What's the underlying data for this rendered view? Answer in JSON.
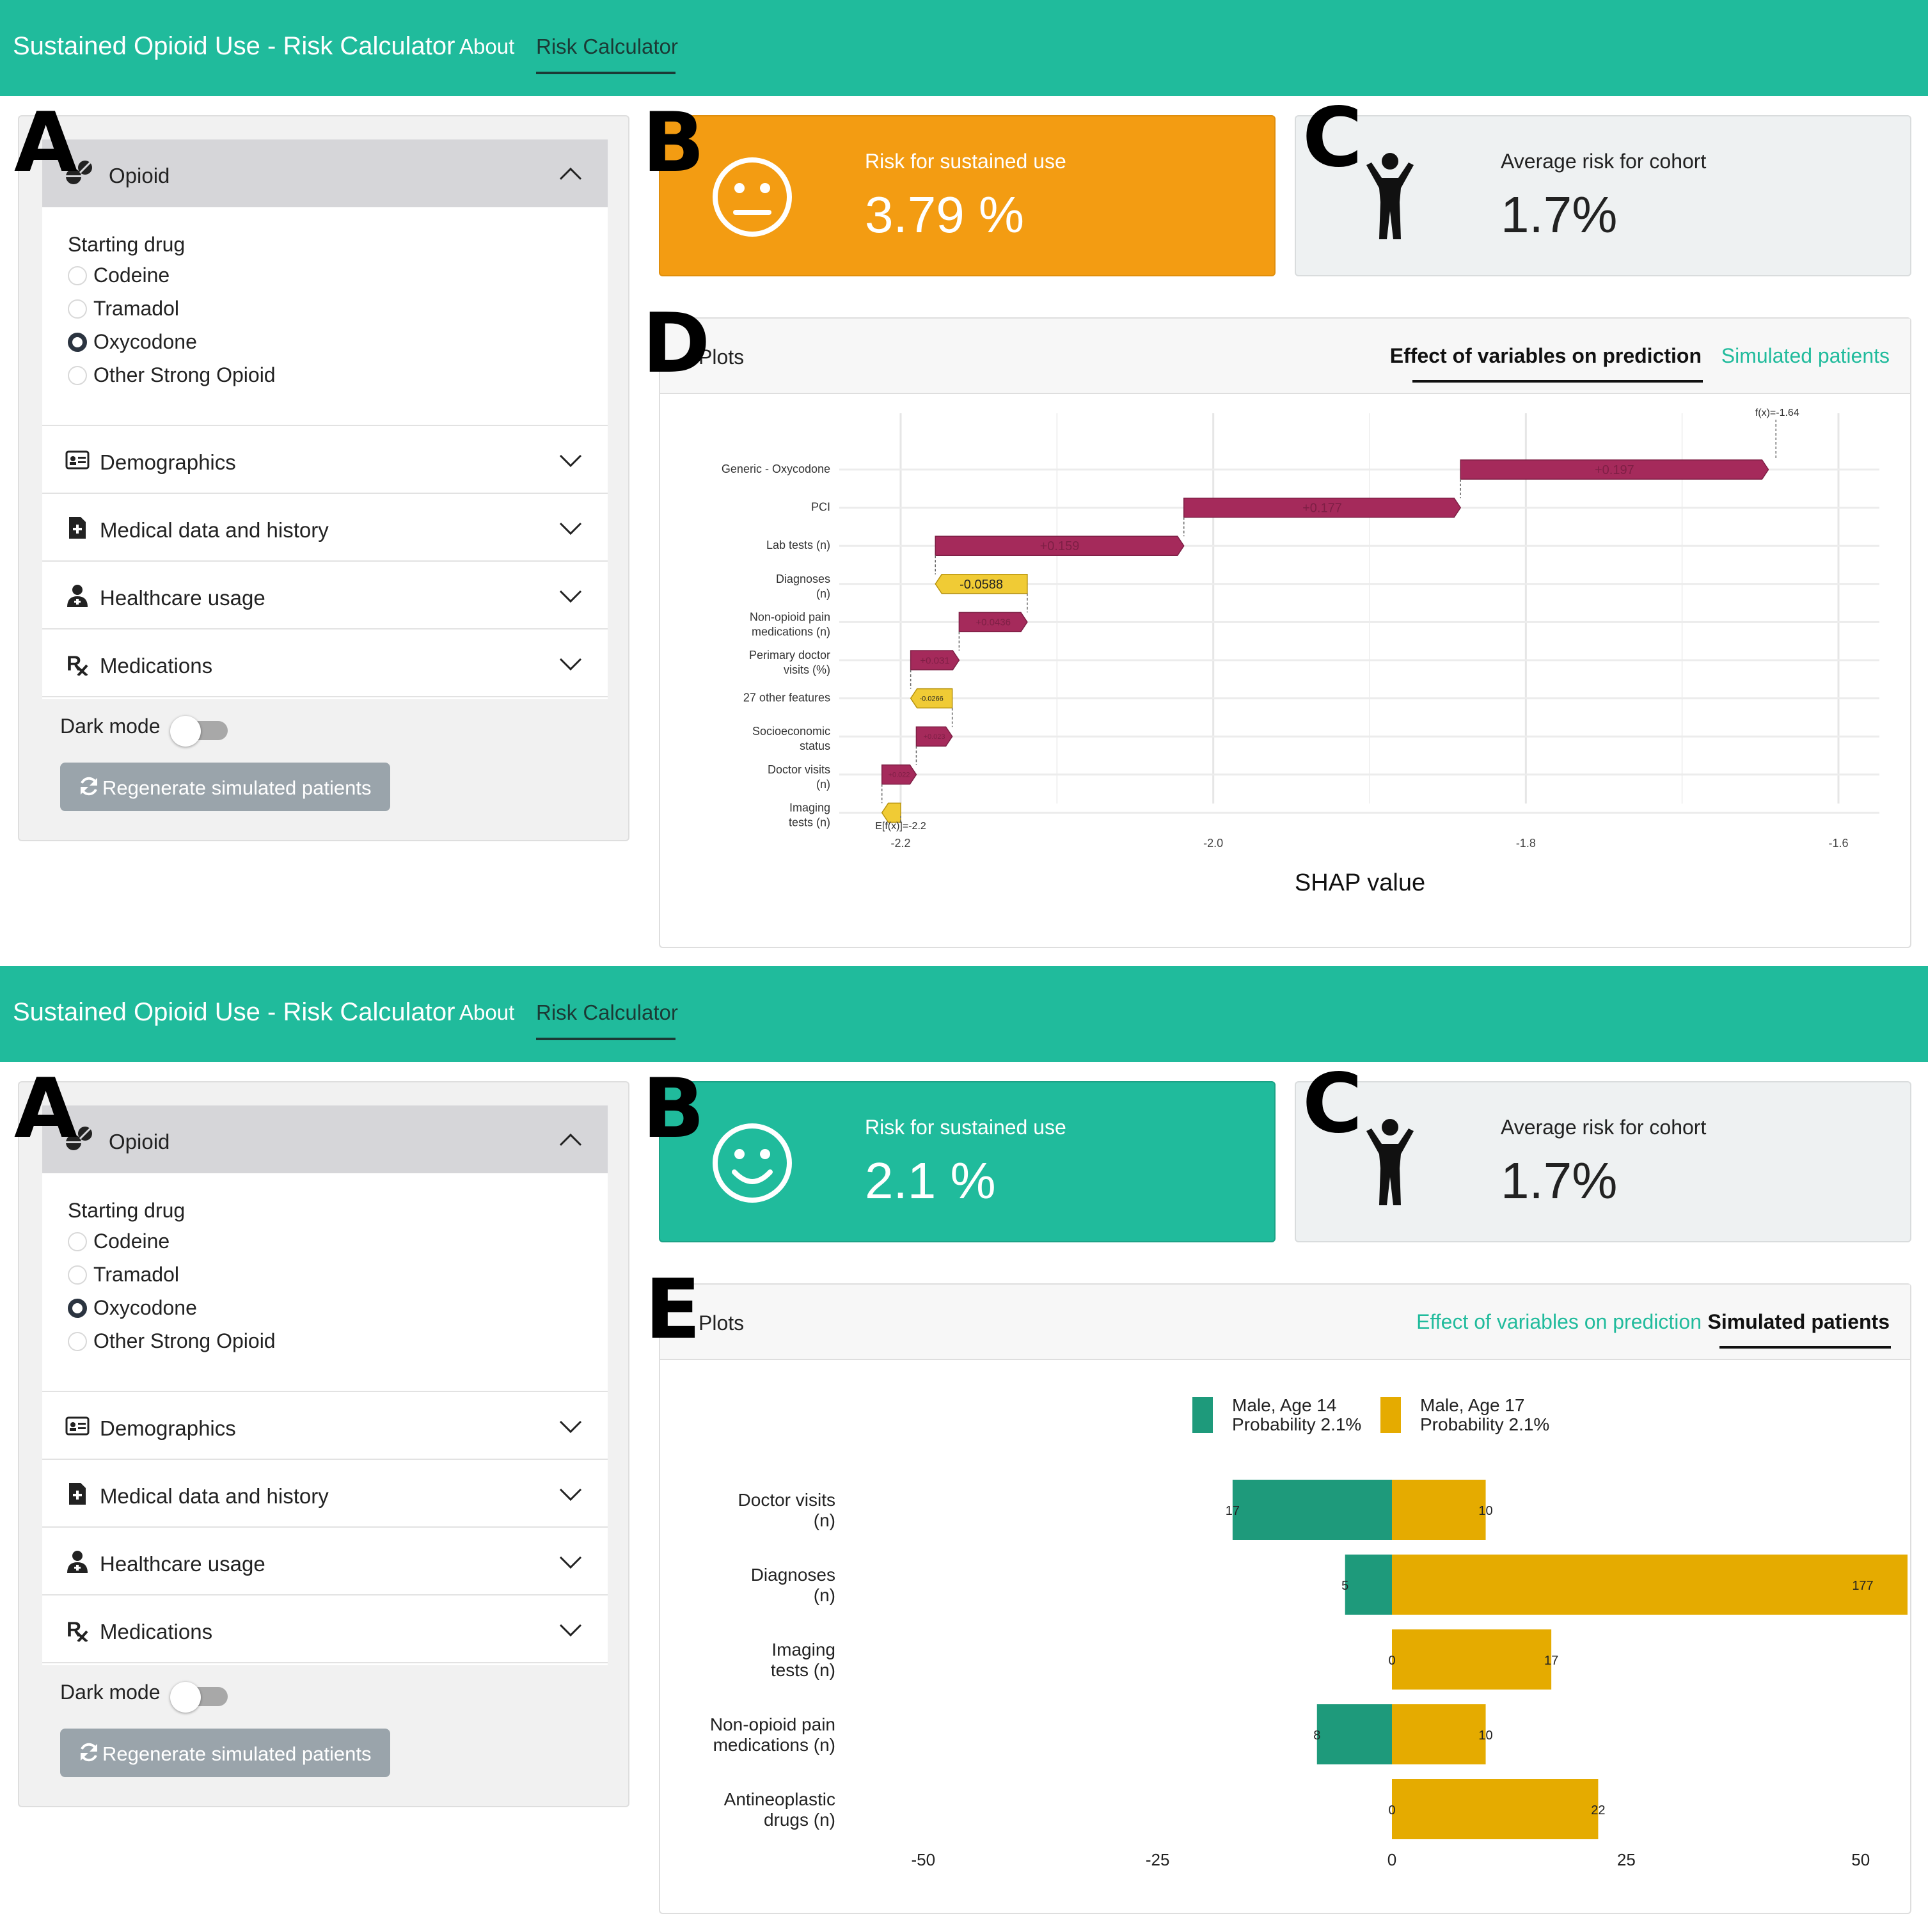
{
  "app": {
    "title": "Sustained Opioid Use - Risk Calculator",
    "nav": {
      "about": "About",
      "risk_calculator": "Risk Calculator"
    }
  },
  "sidebar": {
    "opioid_header": "Opioid",
    "starting_drug_label": "Starting drug",
    "drugs": [
      "Codeine",
      "Tramadol",
      "Oxycodone",
      "Other Strong Opioid"
    ],
    "selected_drug": "Oxycodone",
    "sections": [
      "Demographics",
      "Medical data and history",
      "Healthcare usage",
      "Medications"
    ],
    "section_icons": [
      "id-card-icon",
      "file-medical-icon",
      "user-doctor-icon",
      "prescription-icon"
    ],
    "dark_mode_label": "Dark mode",
    "dark_mode_on": false,
    "regenerate_label": "Regenerate simulated patients"
  },
  "screens": [
    {
      "panel_letters": {
        "a": "A",
        "b": "B",
        "c": "C",
        "d": "D"
      },
      "risk": {
        "title": "Risk for sustained use",
        "value": "3.79 %",
        "face": "neutral-face-icon",
        "color": "#f39c12"
      },
      "cohort": {
        "title": "Average risk for cohort",
        "value": "1.7%"
      },
      "plots": {
        "title": "Plots",
        "tabs": [
          "Effect of variables on prediction",
          "Simulated patients"
        ],
        "active_tab": 0
      }
    },
    {
      "panel_letters": {
        "a": "A",
        "b": "B",
        "c": "C",
        "d": "E"
      },
      "risk": {
        "title": "Risk for sustained use",
        "value": "2.1 %",
        "face": "smile-face-icon",
        "color": "#20bb9c"
      },
      "cohort": {
        "title": "Average risk for cohort",
        "value": "1.7%"
      },
      "plots": {
        "title": "Plots",
        "tabs": [
          "Effect of variables on prediction",
          "Simulated patients"
        ],
        "active_tab": 1
      }
    }
  ],
  "chart_data": [
    {
      "type": "waterfall",
      "xlabel": "SHAP value",
      "xlim": [
        -2.2,
        -1.6
      ],
      "xticks": [
        -2.2,
        -2.0,
        -1.8,
        -1.6
      ],
      "xtick_labels": [
        "-2.2",
        "-2.0",
        "-1.8",
        "-1.6"
      ],
      "base_value": -2.2,
      "base_label": "E[f(x)]=-2.2",
      "final_value": -1.64,
      "final_label": "f(x)=-1.64",
      "features": [
        {
          "label": [
            "Generic - Oxycodone"
          ],
          "value": 0.197,
          "text": "+0.197"
        },
        {
          "label": [
            "PCI"
          ],
          "value": 0.177,
          "text": "+0.177"
        },
        {
          "label": [
            "Lab tests (n)"
          ],
          "value": 0.159,
          "text": "+0.159"
        },
        {
          "label": [
            "Diagnoses",
            "(n)"
          ],
          "value": -0.0588,
          "text": "-0.0588"
        },
        {
          "label": [
            "Non-opioid pain",
            "medications (n)"
          ],
          "value": 0.0436,
          "text": "+0.0436"
        },
        {
          "label": [
            "Perimary doctor",
            "visits (%)"
          ],
          "value": 0.031,
          "text": "+0.031"
        },
        {
          "label": [
            "27 other features"
          ],
          "value": -0.0266,
          "text": "-0.0266"
        },
        {
          "label": [
            "Socioeconomic",
            "status"
          ],
          "value": 0.023,
          "text": "+0.023"
        },
        {
          "label": [
            "Doctor visits",
            "(n)"
          ],
          "value": 0.022,
          "text": "+0.022"
        },
        {
          "label": [
            "Imaging",
            "tests (n)"
          ],
          "value": -0.012,
          "text": ""
        }
      ],
      "colors": {
        "positive": "#a52a5b",
        "negative": "#f0cb35"
      }
    },
    {
      "type": "bar",
      "orientation": "horizontal-diverging",
      "xlim": [
        -55,
        55
      ],
      "xticks": [
        -50,
        -25,
        0,
        25,
        50
      ],
      "xtick_labels": [
        "-50",
        "-25",
        "0",
        "25",
        "50"
      ],
      "categories": [
        [
          "Doctor visits",
          "(n)"
        ],
        [
          "Diagnoses",
          "(n)"
        ],
        [
          "Imaging",
          "tests (n)"
        ],
        [
          "Non-opioid pain",
          "medications (n)"
        ],
        [
          "Antineoplastic",
          "drugs (n)"
        ]
      ],
      "series": [
        {
          "name": "Male, Age 14",
          "legend_sub": "Probability 2.1%",
          "color": "#1e9a7b",
          "values": [
            17,
            5,
            0,
            8,
            0
          ],
          "side": "left"
        },
        {
          "name": "Male, Age 17",
          "legend_sub": "Probability 2.1%",
          "color": "#e5ab00",
          "values": [
            10,
            177,
            17,
            10,
            22
          ],
          "side": "right",
          "plotted_values": [
            10,
            55,
            17,
            10,
            22
          ]
        }
      ]
    }
  ]
}
